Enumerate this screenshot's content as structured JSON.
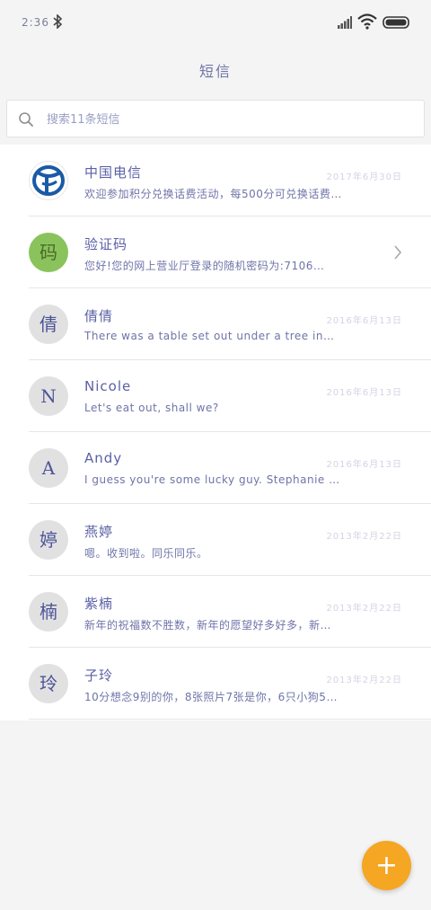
{
  "status_bar": {
    "time": "2:36",
    "icons": [
      "bluetooth-icon",
      "signal-icon",
      "wifi-icon",
      "battery-icon"
    ]
  },
  "header": {
    "title": "短信"
  },
  "search": {
    "placeholder": "搜索11条短信"
  },
  "conversations": [
    {
      "name": "中国电信",
      "preview": "欢迎参加积分兑换话费活动，每500分可兑换话费…",
      "date": "2017年6月30日",
      "avatar": "china-telecom-logo"
    },
    {
      "name": "验证码",
      "preview": "您好!您的网上营业厅登录的随机密码为:7106…",
      "date": "",
      "avatar_text": "码"
    },
    {
      "name": "倩倩",
      "preview": "There was a table set out under a tree in…",
      "date": "2016年6月13日",
      "avatar_text": "倩"
    },
    {
      "name": "Nicole",
      "preview": "Let's eat out, shall we?",
      "date": "2016年6月13日",
      "avatar_text": "N"
    },
    {
      "name": "Andy",
      "preview": "I guess you're some lucky guy. Stephanie …",
      "date": "2016年6月13日",
      "avatar_text": "A"
    },
    {
      "name": "燕婷",
      "preview": "嗯。收到啦。同乐同乐。",
      "date": "2013年2月22日",
      "avatar_text": "婷"
    },
    {
      "name": "紫楠",
      "preview": "新年的祝福数不胜数，新年的愿望好多好多，新…",
      "date": "2013年2月22日",
      "avatar_text": "楠"
    },
    {
      "name": "子玲",
      "preview": "10分想念9别的你，8张照片7张是你，6只小狗5…",
      "date": "2013年2月22日",
      "avatar_text": "玲"
    }
  ],
  "fab": {
    "label": "+"
  },
  "colors": {
    "accent": "#f5a623",
    "text": "#5b60a6",
    "code_avatar": "#8ac35c"
  }
}
